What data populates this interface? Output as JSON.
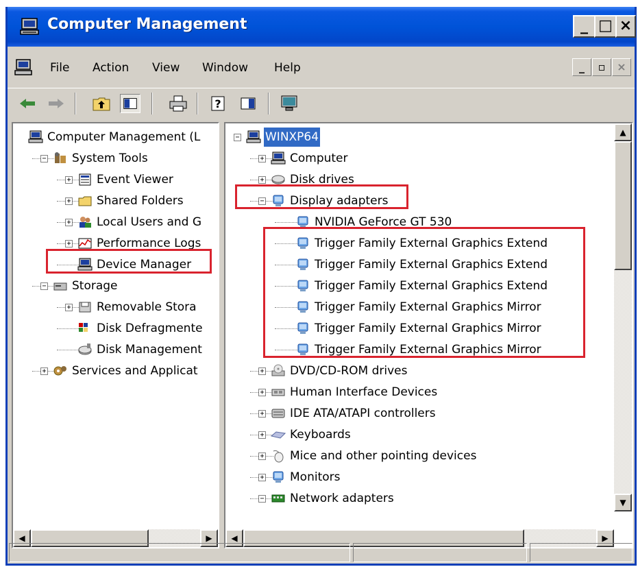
{
  "window": {
    "title": "Computer Management"
  },
  "title_buttons": {
    "minimize": "_",
    "maximize": "□",
    "close": "×"
  },
  "menu": {
    "items": [
      "File",
      "Action",
      "View",
      "Window",
      "Help"
    ]
  },
  "mdi_buttons": {
    "minimize": "_",
    "restore": "▫",
    "close": "×"
  },
  "toolbar": {
    "icons": [
      "back-icon",
      "forward-icon",
      "up-folder-icon",
      "show-hide-tree-icon",
      "print-icon",
      "help-icon",
      "action-pane-icon",
      "monitor-icon"
    ]
  },
  "left_tree": [
    {
      "label": "Computer Management (L",
      "level": 0,
      "icon": "computer-icon",
      "expander": ""
    },
    {
      "label": "System Tools",
      "level": 1,
      "icon": "tools-icon",
      "expander": "−"
    },
    {
      "label": "Event Viewer",
      "level": 2,
      "icon": "event-viewer-icon",
      "expander": "+"
    },
    {
      "label": "Shared Folders",
      "level": 2,
      "icon": "folder-icon",
      "expander": "+"
    },
    {
      "label": "Local Users and G",
      "level": 2,
      "icon": "users-icon",
      "expander": "+"
    },
    {
      "label": "Performance Logs",
      "level": 2,
      "icon": "performance-icon",
      "expander": "+"
    },
    {
      "label": "Device Manager",
      "level": 2,
      "icon": "device-manager-icon",
      "expander": ""
    },
    {
      "label": "Storage",
      "level": 1,
      "icon": "storage-icon",
      "expander": "−"
    },
    {
      "label": "Removable Stora",
      "level": 2,
      "icon": "removable-storage-icon",
      "expander": "+"
    },
    {
      "label": "Disk Defragmente",
      "level": 2,
      "icon": "defrag-icon",
      "expander": ""
    },
    {
      "label": "Disk Management",
      "level": 2,
      "icon": "disk-management-icon",
      "expander": ""
    },
    {
      "label": "Services and Applicat",
      "level": 1,
      "icon": "services-icon",
      "expander": "+"
    }
  ],
  "right_tree": [
    {
      "label": "WINXP64",
      "level": 0,
      "icon": "computer-icon",
      "expander": "−",
      "selected": true
    },
    {
      "label": "Computer",
      "level": 1,
      "icon": "computer-icon",
      "expander": "+"
    },
    {
      "label": "Disk drives",
      "level": 1,
      "icon": "disk-drive-icon",
      "expander": "+"
    },
    {
      "label": "Display adapters",
      "level": 1,
      "icon": "display-adapter-icon",
      "expander": "−"
    },
    {
      "label": "NVIDIA GeForce GT 530",
      "level": 2,
      "icon": "display-adapter-icon",
      "expander": ""
    },
    {
      "label": "Trigger Family External Graphics Extend",
      "level": 2,
      "icon": "display-adapter-icon",
      "expander": ""
    },
    {
      "label": "Trigger Family External Graphics Extend",
      "level": 2,
      "icon": "display-adapter-icon",
      "expander": ""
    },
    {
      "label": "Trigger Family External Graphics Extend",
      "level": 2,
      "icon": "display-adapter-icon",
      "expander": ""
    },
    {
      "label": "Trigger Family External Graphics Mirror",
      "level": 2,
      "icon": "display-adapter-icon",
      "expander": ""
    },
    {
      "label": "Trigger Family External Graphics Mirror",
      "level": 2,
      "icon": "display-adapter-icon",
      "expander": ""
    },
    {
      "label": "Trigger Family External Graphics Mirror",
      "level": 2,
      "icon": "display-adapter-icon",
      "expander": ""
    },
    {
      "label": "DVD/CD-ROM drives",
      "level": 1,
      "icon": "cd-drive-icon",
      "expander": "+"
    },
    {
      "label": "Human Interface Devices",
      "level": 1,
      "icon": "hid-icon",
      "expander": "+"
    },
    {
      "label": "IDE ATA/ATAPI controllers",
      "level": 1,
      "icon": "ide-controller-icon",
      "expander": "+"
    },
    {
      "label": "Keyboards",
      "level": 1,
      "icon": "keyboard-icon",
      "expander": "+"
    },
    {
      "label": "Mice and other pointing devices",
      "level": 1,
      "icon": "mouse-icon",
      "expander": "+"
    },
    {
      "label": "Monitors",
      "level": 1,
      "icon": "monitor-icon",
      "expander": "+"
    },
    {
      "label": "Network adapters",
      "level": 1,
      "icon": "network-adapter-icon",
      "expander": "−"
    }
  ],
  "colors": {
    "highlight_box": "#d9232e",
    "selection": "#316ac5",
    "titlebar": "#0053d8"
  }
}
